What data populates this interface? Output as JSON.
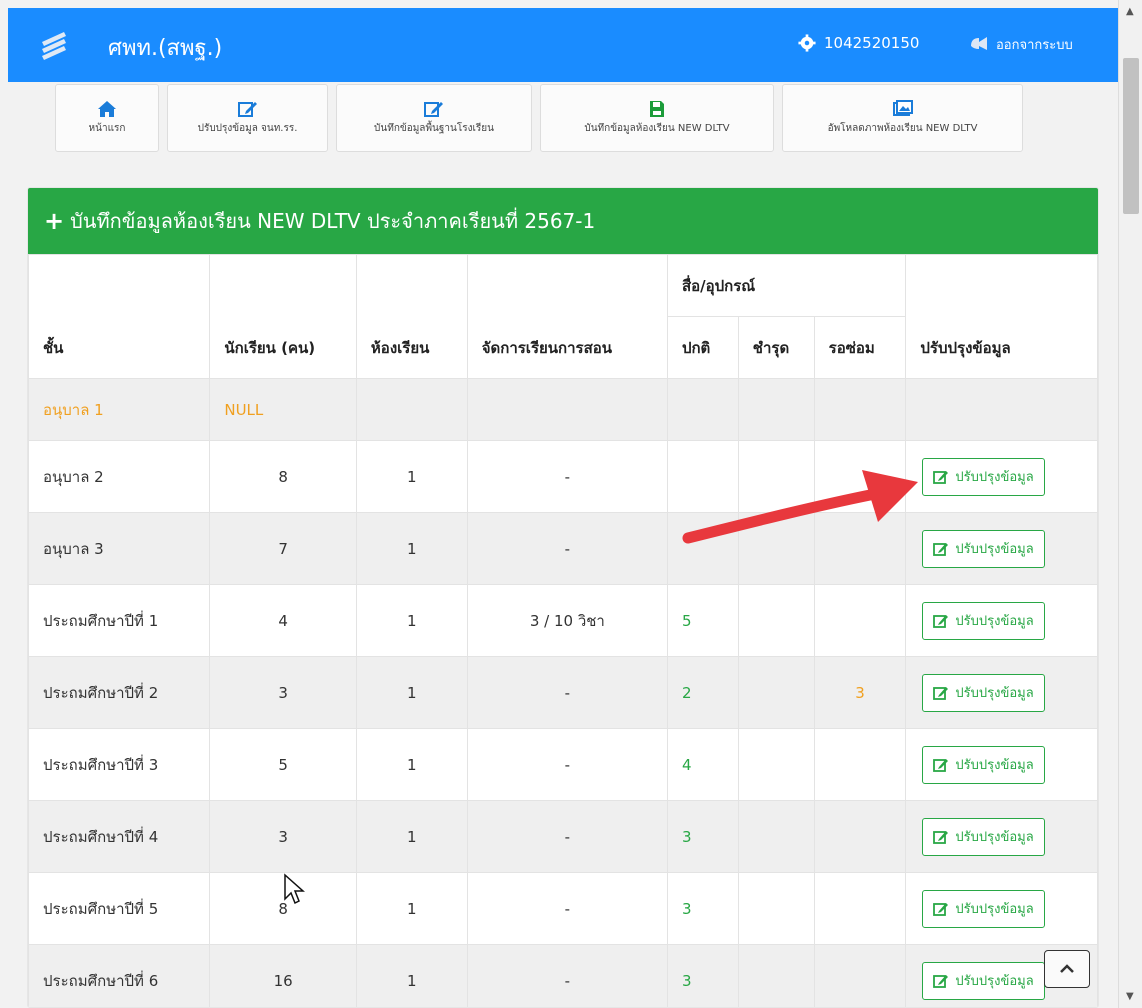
{
  "navbar": {
    "brand": "ศพท.(สพฐ.)",
    "user_id": "1042520150",
    "logout_label": "ออกจากระบบ",
    "color": "#1a8cff"
  },
  "toolbar": [
    {
      "label": "หน้าแรก",
      "icon": "home-icon"
    },
    {
      "label": "ปรับปรุงข้อมูล จนท.รร.",
      "icon": "edit-icon"
    },
    {
      "label": "บันทึกข้อมูลพื้นฐานโรงเรียน",
      "icon": "edit-icon"
    },
    {
      "label": "บันทึกข้อมูลห้องเรียน NEW DLTV",
      "icon": "save-icon"
    },
    {
      "label": "อัพโหลดภาพห้องเรียน NEW DLTV",
      "icon": "image-icon"
    }
  ],
  "panel": {
    "title": "บันทึกข้อมูลห้องเรียน NEW DLTV ประจำภาคเรียนที่ 2567-1",
    "color": "#28a745"
  },
  "table": {
    "headers": {
      "grade": "ชั้น",
      "students": "นักเรียน (คน)",
      "rooms": "ห้องเรียน",
      "teaching": "จัดการเรียนการสอน",
      "media_group": "สื่อ/อุปกรณ์",
      "normal": "ปกติ",
      "broken": "ชำรุด",
      "repair": "รอซ่อม",
      "update": "ปรับปรุงข้อมูล"
    },
    "edit_label": "ปรับปรุงข้อมูล",
    "rows": [
      {
        "grade": "อนุบาล 1",
        "students": "NULL",
        "rooms": "",
        "teaching": "",
        "normal": "",
        "broken": "",
        "repair": "",
        "has_button": false
      },
      {
        "grade": "อนุบาล 2",
        "students": "8",
        "rooms": "1",
        "teaching": "-",
        "normal": "",
        "broken": "",
        "repair": "",
        "has_button": true
      },
      {
        "grade": "อนุบาล 3",
        "students": "7",
        "rooms": "1",
        "teaching": "-",
        "normal": "",
        "broken": "",
        "repair": "",
        "has_button": true
      },
      {
        "grade": "ประถมศึกษาปีที่ 1",
        "students": "4",
        "rooms": "1",
        "teaching": "3 / 10 วิชา",
        "normal": "5",
        "broken": "",
        "repair": "",
        "has_button": true
      },
      {
        "grade": "ประถมศึกษาปีที่ 2",
        "students": "3",
        "rooms": "1",
        "teaching": "-",
        "normal": "2",
        "broken": "",
        "repair": "3",
        "has_button": true
      },
      {
        "grade": "ประถมศึกษาปีที่ 3",
        "students": "5",
        "rooms": "1",
        "teaching": "-",
        "normal": "4",
        "broken": "",
        "repair": "",
        "has_button": true
      },
      {
        "grade": "ประถมศึกษาปีที่ 4",
        "students": "3",
        "rooms": "1",
        "teaching": "-",
        "normal": "3",
        "broken": "",
        "repair": "",
        "has_button": true
      },
      {
        "grade": "ประถมศึกษาปีที่ 5",
        "students": "8",
        "rooms": "1",
        "teaching": "-",
        "normal": "3",
        "broken": "",
        "repair": "",
        "has_button": true
      },
      {
        "grade": "ประถมศึกษาปีที่ 6",
        "students": "16",
        "rooms": "1",
        "teaching": "-",
        "normal": "3",
        "broken": "",
        "repair": "",
        "has_button": true
      }
    ]
  }
}
